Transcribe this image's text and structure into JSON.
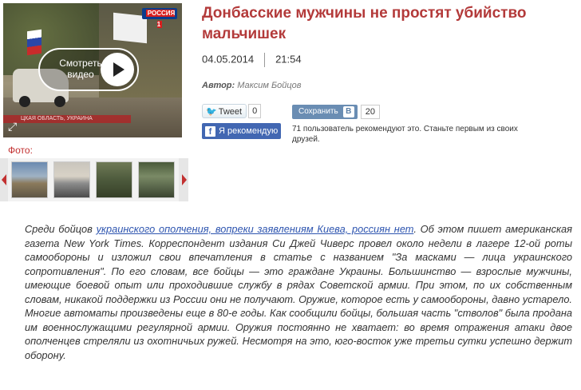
{
  "video": {
    "channel_logo": "РОССИЯ 1",
    "watch_label_line1": "Смотреть",
    "watch_label_line2": "видео",
    "caption_strip": "ЦКАЯ ОБЛАСТЬ, УКРАИНА"
  },
  "gallery": {
    "label": "Фото:",
    "thumbnails": 4
  },
  "article": {
    "title": "Донбасские мужчины не простят убийство мальчишек",
    "date": "04.05.2014",
    "time": "21:54",
    "author_label": "Автор:",
    "author_name": "Максим Бойцов",
    "body_before_link": "Среди бойцов ",
    "body_link": "украинского ополчения, вопреки заявлениям Киева, россиян нет",
    "body_after_link": ". Об этом пишет американская газета New York Times. Корреспондент издания Си Джей Чиверс провел около недели в лагере 12-ой роты самообороны и изложил свои впечатления в статье с названием \"За масками — лица украинского сопротивления\". По его словам, все бойцы — это граждане Украины. Большинство — взрослые мужчины, имеющие боевой опыт или проходившие службу в рядах Советской армии. При этом, по их собственным словам, никакой поддержки из России они не получают. Оружие, которое есть у самообороны, давно устарело. Многие автоматы произведены еще в 80-е годы. Как сообщили бойцы, большая часть \"стволов\" была продана им военнослужащими регулярной армии. Оружия постоянно не хватает: во время отражения атаки двое ополченцев стреляли из охотничьих ружей. Несмотря на это, юго-восток уже третьи сутки успешно держит оборону."
  },
  "social": {
    "tweet_label": "Tweet",
    "tweet_count": "0",
    "vk_label": "Сохранить",
    "vk_letter": "В",
    "vk_count": "20",
    "fb_letter": "f",
    "fb_label": "Я рекомендую",
    "fb_text": "71 пользователь рекомендуют это. Станьте первым из своих друзей."
  }
}
